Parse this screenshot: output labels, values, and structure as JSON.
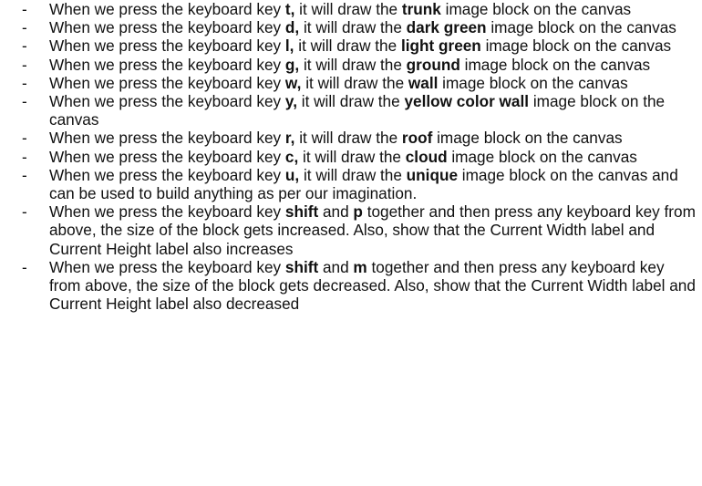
{
  "bullet": "-",
  "items": [
    {
      "pre": "When we press the keyboard key ",
      "key": "t,",
      "mid": " it will draw the ",
      "block": "trunk",
      "post": " image block on the canvas"
    },
    {
      "pre": "When we press the keyboard key ",
      "key": "d,",
      "mid": " it will draw the ",
      "block": "dark green",
      "post": " image block on the canvas"
    },
    {
      "pre": "When we press the keyboard key ",
      "key": "l,",
      "mid": " it will draw the ",
      "block": "light green",
      "post": " image block on the canvas"
    },
    {
      "pre": "When we press the keyboard key ",
      "key": "g,",
      "mid": " it will draw the ",
      "block": "ground",
      "post": " image block on the canvas"
    },
    {
      "pre": "When we press the keyboard key ",
      "key": "w,",
      "mid": " it will draw the ",
      "block": "wall",
      "post": " image block on the canvas"
    },
    {
      "pre": "When we press the keyboard key ",
      "key": "y,",
      "mid": " it will draw the ",
      "block": "yellow color wall",
      "post": " image block on the canvas"
    },
    {
      "pre": "When we press the keyboard key ",
      "key": "r,",
      "mid": " it will draw the ",
      "block": "roof",
      "post": " image block on the canvas"
    },
    {
      "pre": "When we press the keyboard key ",
      "key": "c,",
      "mid": " it will draw the ",
      "block": "cloud",
      "post": " image block on the canvas"
    },
    {
      "pre": "When we press the keyboard key ",
      "key": "u,",
      "mid": " it will draw the ",
      "block": "unique",
      "post": " image block on the canvas and can be used to build anything as per our imagination."
    }
  ],
  "size_items": [
    {
      "pre": "When we press the keyboard key ",
      "key1": "shift",
      "and": " and ",
      "key2": "p",
      "post": " together and then press any keyboard key from above, the size of the block gets increased. Also, show that the Current Width label and Current Height label also increases"
    },
    {
      "pre": "When we press the keyboard key ",
      "key1": "shift",
      "and": " and ",
      "key2": "m",
      "post": " together and then press any keyboard key from above, the size of the block gets decreased. Also, show that the Current Width label and Current Height label also decreased"
    }
  ]
}
